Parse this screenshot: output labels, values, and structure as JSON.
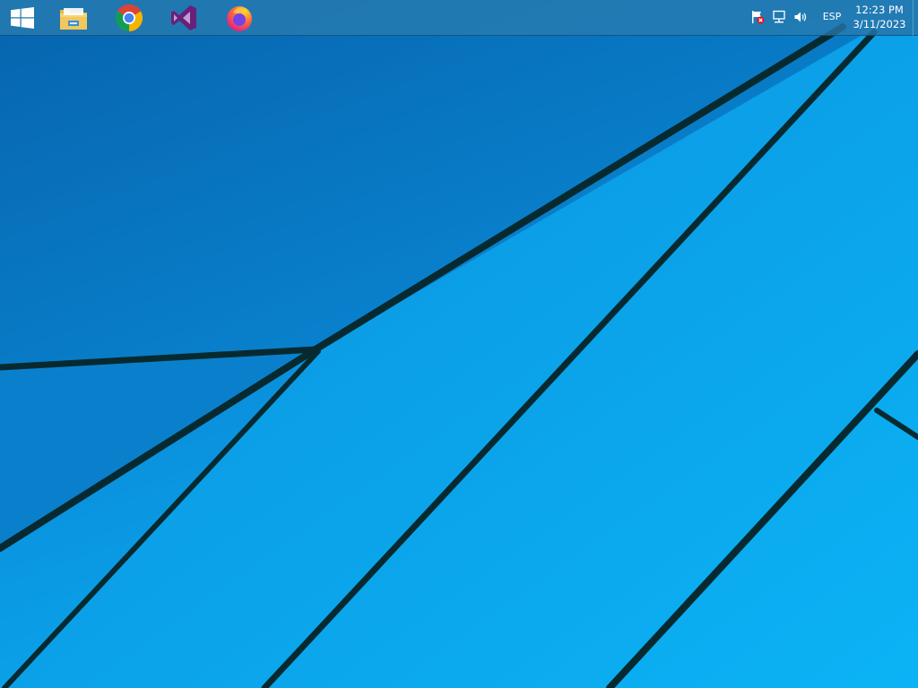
{
  "taskbar": {
    "start": {
      "icon": "windows-logo-icon"
    },
    "pinned": [
      {
        "icon": "file-explorer-icon"
      },
      {
        "icon": "chrome-icon"
      },
      {
        "icon": "visual-studio-icon"
      },
      {
        "icon": "firefox-icon"
      }
    ],
    "tray": {
      "icons": [
        "action-center-flag-icon",
        "network-icon",
        "volume-icon"
      ],
      "language": "ESP",
      "time": "12:23 PM",
      "date": "3/11/2023"
    }
  },
  "wallpaper": {
    "colors": {
      "base_dark": "#0a72c0",
      "base_light": "#0bb6f7",
      "lines": "#062a30"
    }
  }
}
